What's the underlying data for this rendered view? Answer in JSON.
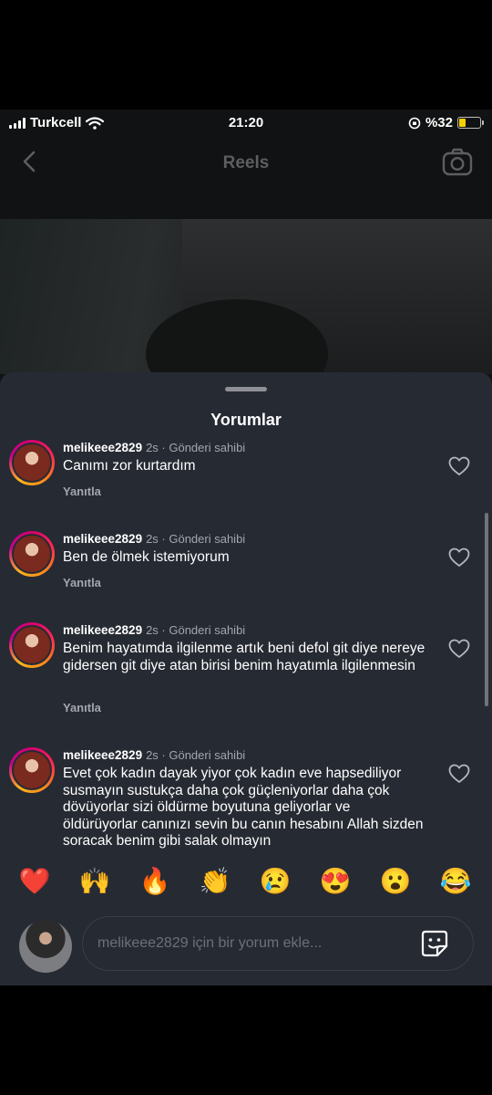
{
  "status_bar": {
    "carrier": "Turkcell",
    "time": "21:20",
    "battery": "%32",
    "battery_level": 0.32
  },
  "nav": {
    "title": "Reels",
    "back_icon": "chevron-left-icon",
    "camera_icon": "camera-icon"
  },
  "sheet": {
    "title": "Yorumlar"
  },
  "comments": [
    {
      "username": "melikeee2829",
      "meta": "2s · Gönderi sahibi",
      "text": "Canımı zor kurtardım",
      "reply": "Yanıtla"
    },
    {
      "username": "melikeee2829",
      "meta": "2s · Gönderi sahibi",
      "text": "Ben de ölmek istemiyorum",
      "reply": "Yanıtla"
    },
    {
      "username": "melikeee2829",
      "meta": "2s · Gönderi sahibi",
      "text": "Benim hayatımda ilgilenme artık beni defol git diye nereye gidersen git diye atan birisi benim hayatımla ilgilenmesin",
      "reply": "Yanıtla"
    },
    {
      "username": "melikeee2829",
      "meta": "2s · Gönderi sahibi",
      "text": "Evet çok kadın dayak yiyor çok kadın eve hapsediliyor susmayın sustukça daha çok güçleniyorlar daha çok dövüyorlar sizi öldürme boyutuna geliyorlar ve öldürüyorlar canınızı sevin bu canın hesabını Allah sizden soracak benim gibi salak olmayın"
    }
  ],
  "emojis": [
    "❤️",
    "🙌",
    "🔥",
    "👏",
    "😢",
    "😍",
    "😮",
    "😂"
  ],
  "input": {
    "placeholder": "melikeee2829 için bir yorum ekle..."
  },
  "colors": {
    "sheet_bg": "#262a33",
    "muted_text": "#a3a6ad",
    "battery": "#f5d000",
    "story_ring": "#d6006f"
  }
}
